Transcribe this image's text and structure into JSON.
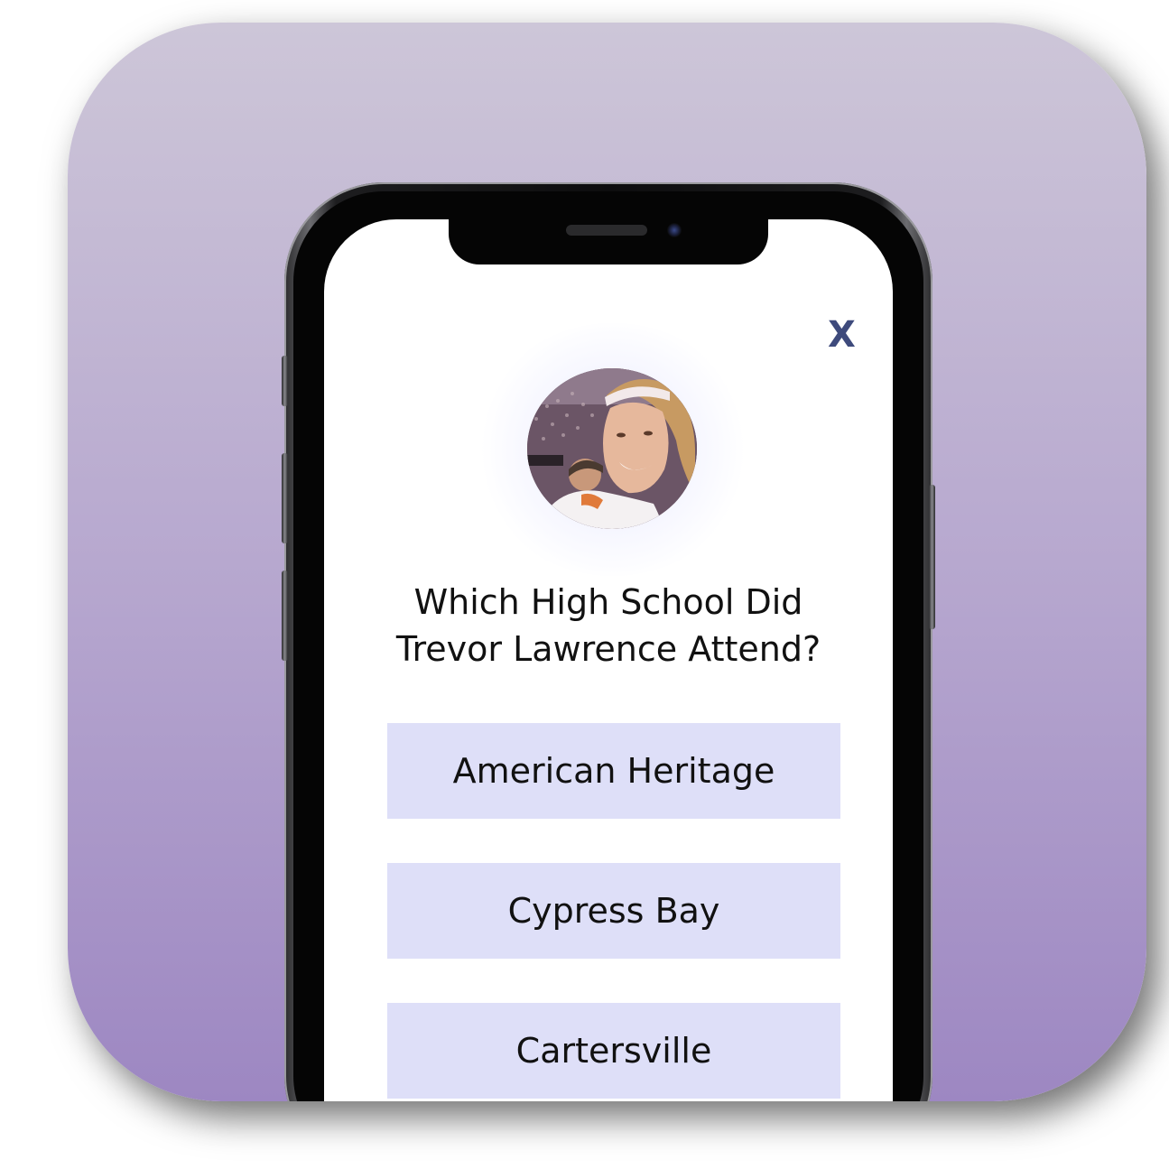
{
  "quiz": {
    "close_label": "X",
    "question_line1": "Which High School Did",
    "question_line2": "Trevor Lawrence Attend?",
    "options": [
      {
        "label": "American Heritage"
      },
      {
        "label": "Cypress Bay"
      },
      {
        "label": "Cartersville"
      }
    ]
  },
  "colors": {
    "background_top": "#cdc6d8",
    "background_bottom": "#9d87c2",
    "option_bg": "#dedff8",
    "close_color": "#3e4a7c"
  },
  "icons": {
    "close": "close-icon",
    "avatar": "player-photo"
  }
}
